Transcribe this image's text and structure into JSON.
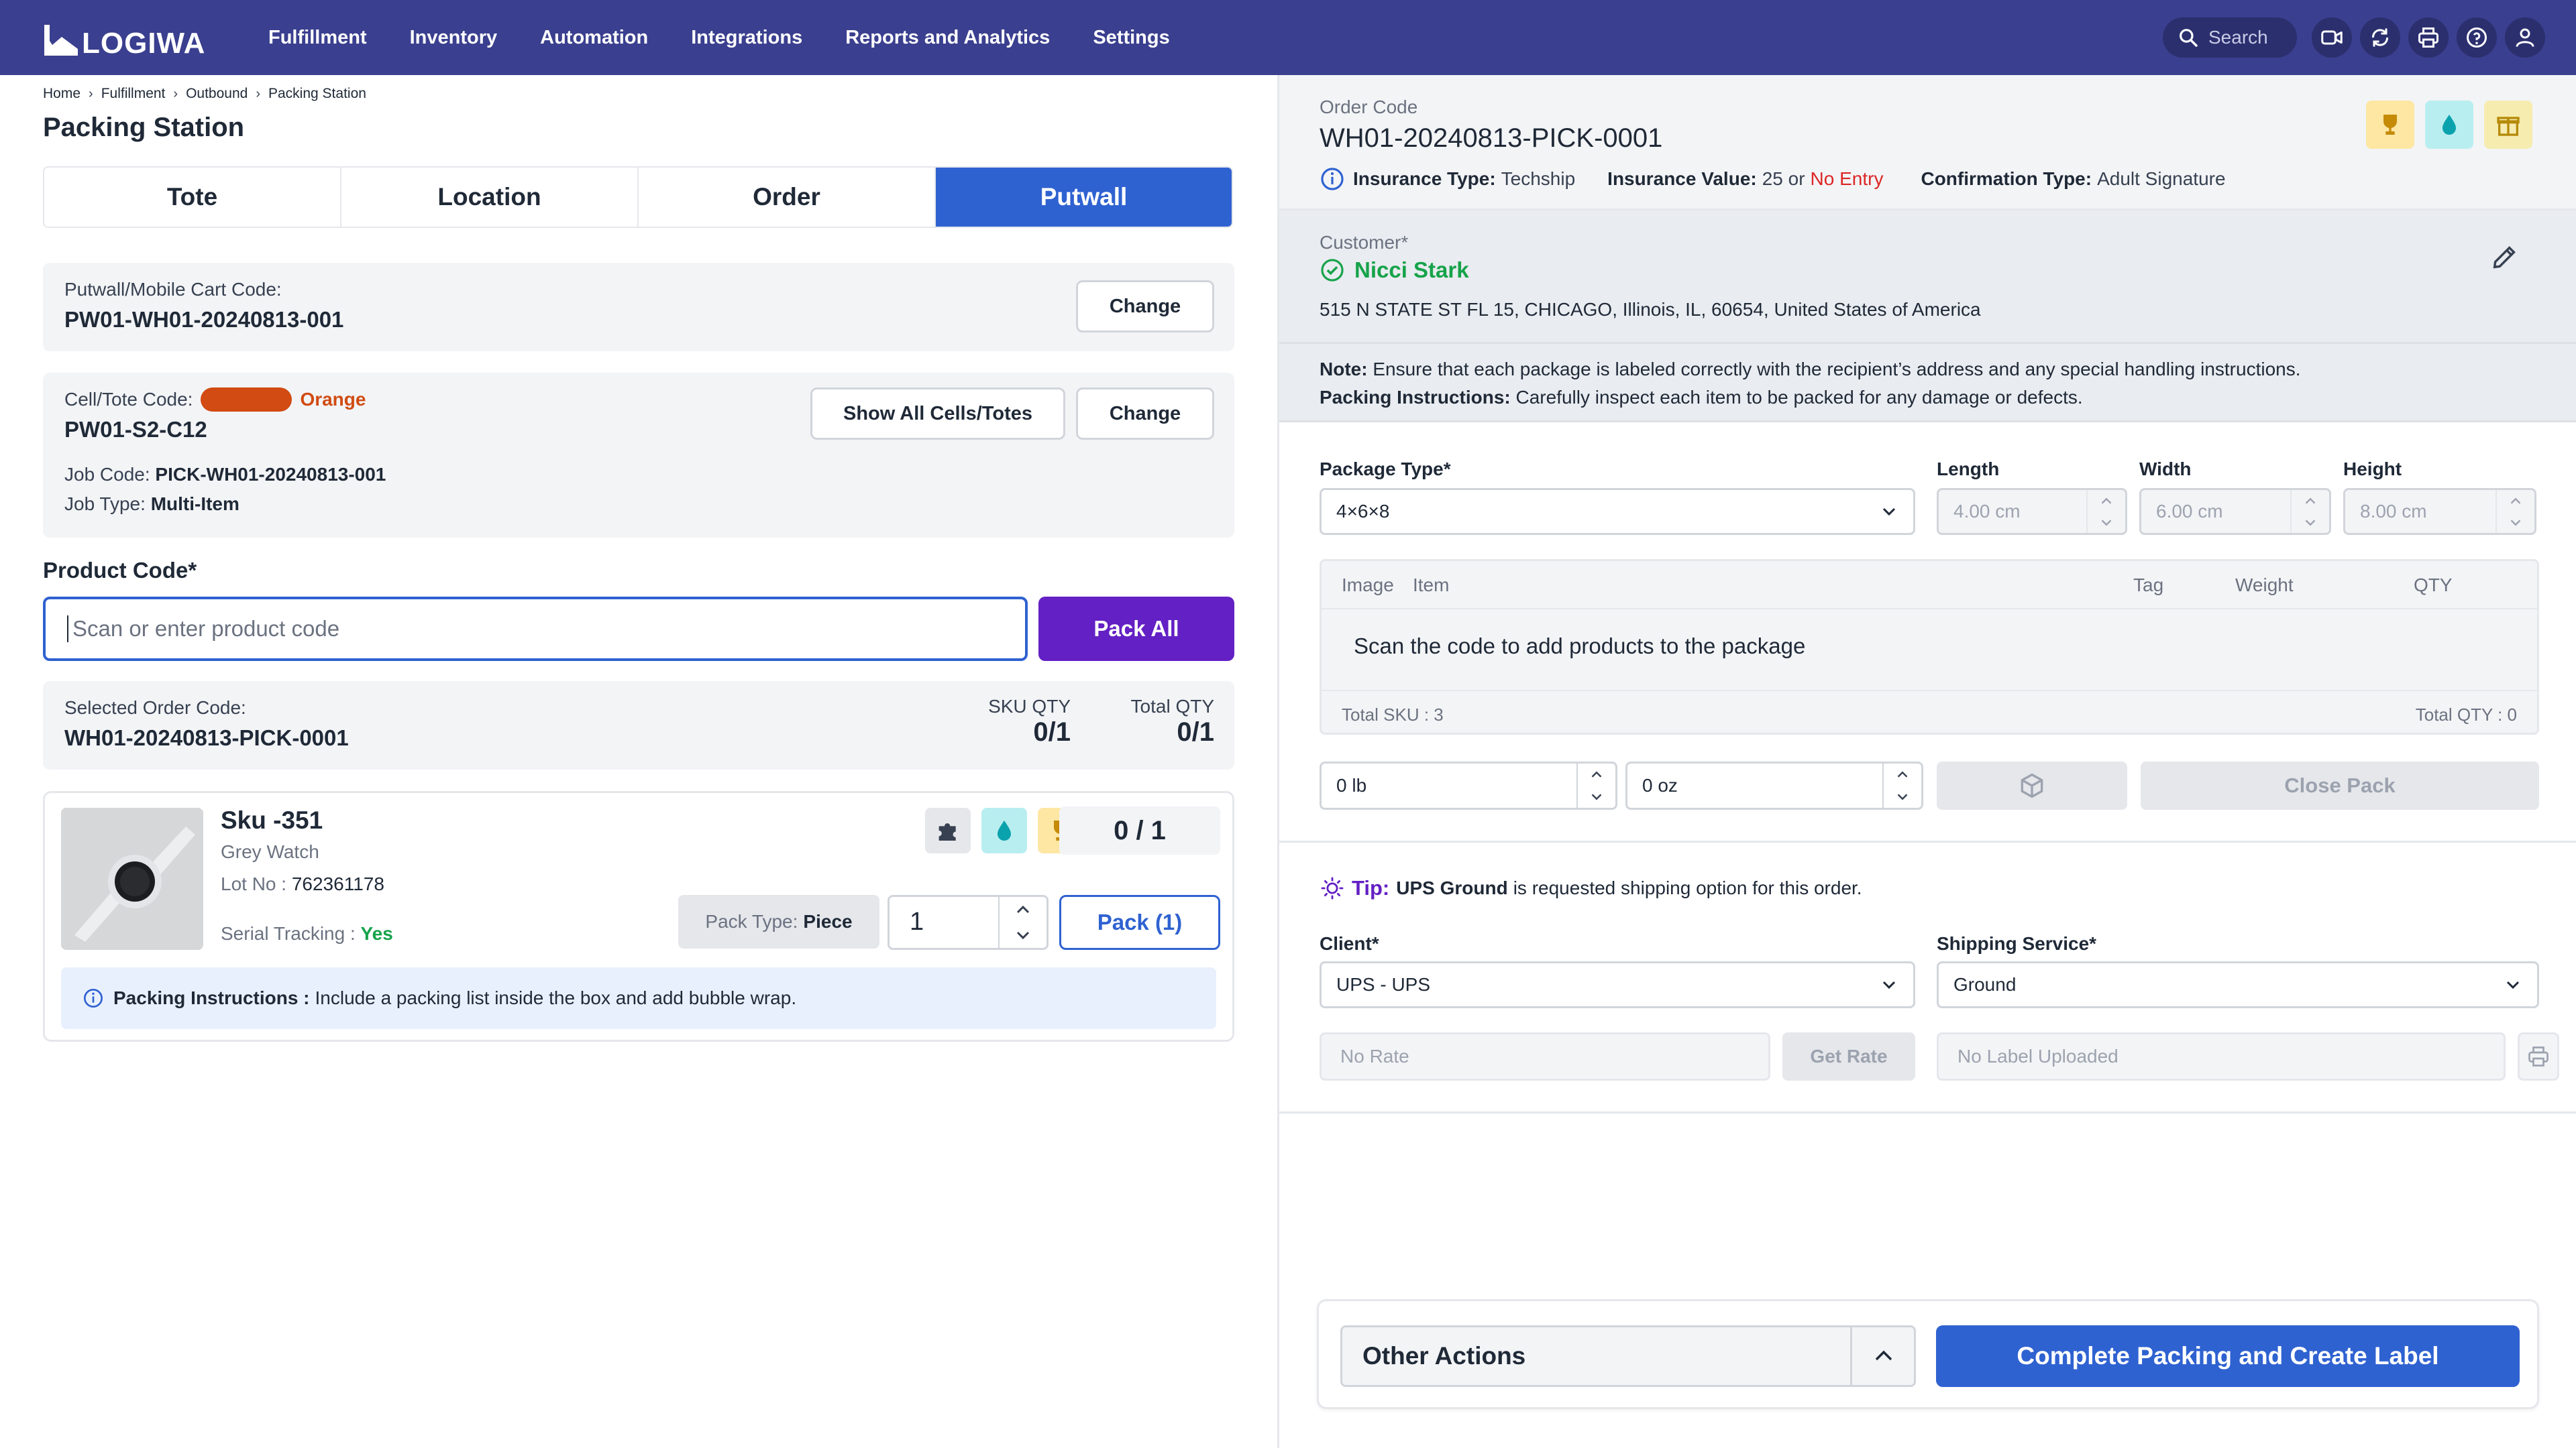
{
  "app": {
    "logo_text": "LOGIWA",
    "nav": [
      "Fulfillment",
      "Inventory",
      "Automation",
      "Integrations",
      "Reports and Analytics",
      "Settings"
    ],
    "search_placeholder": "Search",
    "icons": [
      "video-icon",
      "sync-icon",
      "printer-icon",
      "help-icon",
      "user-icon"
    ]
  },
  "breadcrumb": [
    "Home",
    "Fulfillment",
    "Outbound",
    "Packing Station"
  ],
  "page_title": "Packing Station",
  "tabs": [
    "Tote",
    "Location",
    "Order",
    "Putwall"
  ],
  "active_tab": "Putwall",
  "putwall": {
    "label": "Putwall/Mobile Cart Code:",
    "value": "PW01-WH01-20240813-001",
    "change_label": "Change"
  },
  "cell": {
    "label": "Cell/Tote Code:",
    "color_name": "Orange",
    "color_hex": "#d14b12",
    "value": "PW01-S2-C12",
    "job_code_label": "Job Code:",
    "job_code": "PICK-WH01-20240813-001",
    "job_type_label": "Job Type:",
    "job_type": "Multi-Item",
    "show_all_label": "Show All Cells/Totes",
    "change_label": "Change"
  },
  "product": {
    "label": "Product Code*",
    "placeholder": "Scan or enter product code",
    "pack_all_label": "Pack All"
  },
  "selected_order": {
    "label": "Selected Order Code:",
    "value": "WH01-20240813-PICK-0001",
    "sku_qty_label": "SKU QTY",
    "sku_qty": "0/1",
    "total_qty_label": "Total QTY",
    "total_qty": "0/1"
  },
  "item": {
    "sku": "Sku -351",
    "name": "Grey Watch",
    "lot_label": "Lot No :",
    "lot": "762361178",
    "serial_label": "Serial Tracking :",
    "serial": "Yes",
    "qty": "0 / 1",
    "pack_type_label": "Pack Type:",
    "pack_type": "Piece",
    "stepper_value": "1",
    "pack_label": "Pack (1)",
    "instructions_label": "Packing Instructions :",
    "instructions": "Include a packing list inside the box and add bubble wrap.",
    "badges": [
      "puzzle-icon",
      "drop-icon",
      "trophy-icon"
    ]
  },
  "order": {
    "code_label": "Order Code",
    "code": "WH01-20240813-PICK-0001",
    "insurance_type_label": "Insurance Type:",
    "insurance_type": "Techship",
    "insurance_value_label": "Insurance Value:",
    "insurance_value": "25 or",
    "insurance_value_alt": "No Entry",
    "confirmation_label": "Confirmation Type:",
    "confirmation": "Adult Signature"
  },
  "customer": {
    "label": "Customer*",
    "name": "Nicci Stark",
    "address": "515 N STATE ST FL 15, CHICAGO, Illinois, IL, 60654, United States of America",
    "note_label": "Note:",
    "note": "Ensure that each package is labeled correctly with the recipient’s address and any special handling instructions.",
    "packing_label": "Packing Instructions:",
    "packing": "Carefully inspect each item to be packed for any damage or defects."
  },
  "package": {
    "type_label": "Package Type*",
    "type_value": "4×6×8",
    "length_label": "Length",
    "length": "4.00 cm",
    "width_label": "Width",
    "width": "6.00 cm",
    "height_label": "Height",
    "height": "8.00 cm",
    "table_headers": [
      "Image",
      "Item",
      "Tag",
      "Weight",
      "QTY"
    ],
    "empty_text": "Scan the code to add products to the package",
    "total_sku": "Total SKU : 3",
    "total_qty": "Total QTY : 0",
    "weight_lb": "0 lb",
    "weight_oz": "0 oz",
    "close_pack_label": "Close Pack"
  },
  "shipping": {
    "tip_label": "Tip:",
    "tip_bold": "UPS Ground",
    "tip_text": "is requested shipping option for this order.",
    "client_label": "Client*",
    "client_value": "UPS - UPS",
    "service_label": "Shipping Service*",
    "service_value": "Ground",
    "rate_placeholder": "No Rate",
    "get_rate_label": "Get Rate",
    "label_placeholder": "No Label Uploaded"
  },
  "actions": {
    "other_label": "Other Actions",
    "complete_label": "Complete Packing and Create Label"
  }
}
